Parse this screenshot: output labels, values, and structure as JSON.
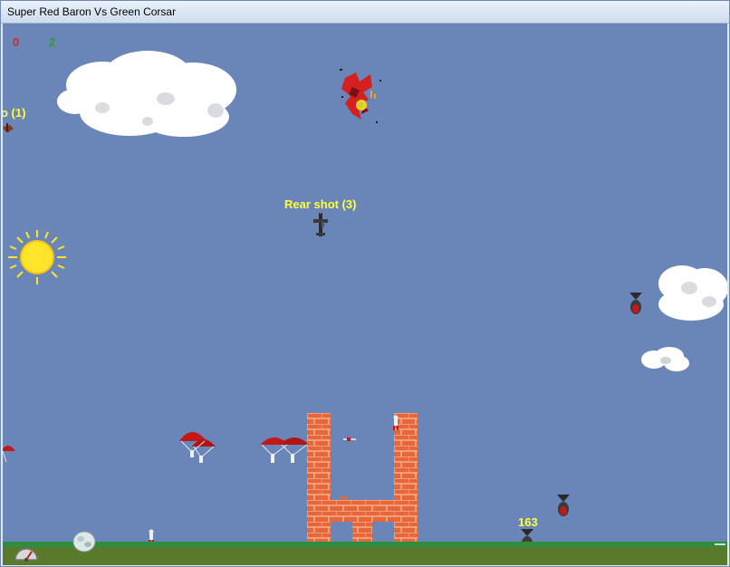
{
  "window": {
    "title": "Super Red Baron Vs Green Corsar"
  },
  "scores": {
    "red": "0",
    "green": "2"
  },
  "labels": {
    "left_powerup": "o (1)",
    "rear_shot": "Rear shot (3)",
    "counter": "163"
  },
  "colors": {
    "sky": "#6a86b9",
    "grass": "#2e8d3e",
    "brick": "#e8673a",
    "mortar": "#f3b08e",
    "sun": "#ffe52a",
    "red_score": "#e02222",
    "green_score": "#2e9a2e",
    "label_yellow": "#ffff3c"
  },
  "icons": {
    "sun": "sun-icon",
    "speedometer": "speedometer-icon",
    "boulder": "boulder-icon",
    "bomb": "bomb-icon",
    "parachute": "parachute-icon",
    "plane": "plane-icon",
    "explosion": "explosion-icon"
  }
}
